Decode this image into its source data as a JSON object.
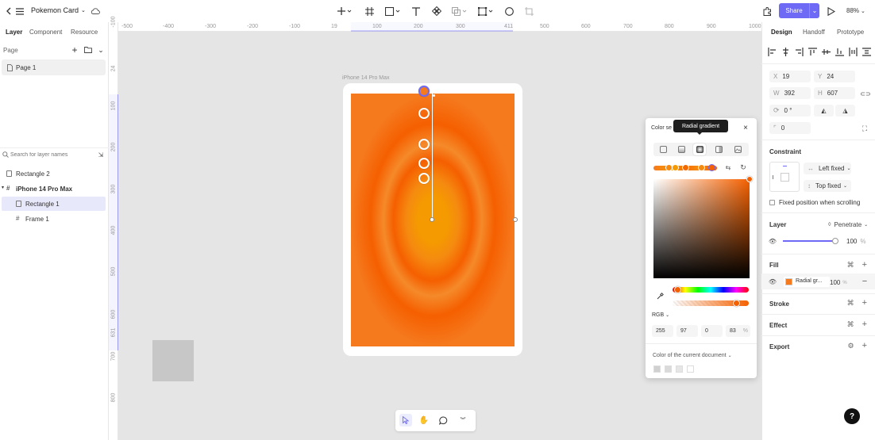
{
  "topbar": {
    "file_name": "Pokemon Card",
    "share_label": "Share",
    "zoom": "88%"
  },
  "left_panel": {
    "tabs": [
      "Layer",
      "Component",
      "Resource"
    ],
    "page_header": "Page",
    "pages": [
      "Page 1"
    ],
    "search_placeholder": "Search for layer names",
    "layers": [
      {
        "name": "Rectangle 2",
        "indent": 0,
        "bold": false,
        "selected": false
      },
      {
        "name": "iPhone 14 Pro Max",
        "indent": 0,
        "bold": true,
        "selected": false
      },
      {
        "name": "Rectangle 1",
        "indent": 1,
        "bold": false,
        "selected": true
      },
      {
        "name": "Frame 1",
        "indent": 1,
        "bold": false,
        "selected": false
      }
    ]
  },
  "ruler_h": [
    "-500",
    "-400",
    "-300",
    "-200",
    "-100",
    "19",
    "100",
    "200",
    "300",
    "411",
    "500",
    "600",
    "700",
    "800",
    "900",
    "1000"
  ],
  "ruler_v": [
    "-100",
    "24",
    "100",
    "200",
    "300",
    "400",
    "500",
    "600",
    "631",
    "700",
    "800"
  ],
  "canvas": {
    "frame_label": "iPhone 14 Pro Max"
  },
  "color_popup": {
    "title": "Color se",
    "tooltip": "Radial gradient",
    "mode": "RGB",
    "r": "255",
    "g": "97",
    "b": "0",
    "alpha": "83",
    "alpha_unit": "%",
    "doc_colors_label": "Color of the current document",
    "doc_swatches": [
      "#d0d0d0",
      "#dadada",
      "#e6e6e6",
      "#ffffff"
    ],
    "hue_fraction": 0.06,
    "opacity_fraction": 0.83
  },
  "right_panel": {
    "tabs": [
      "Design",
      "Handoff",
      "Prototype"
    ],
    "x_label": "X",
    "x": "19",
    "y_label": "Y",
    "y": "24",
    "w_label": "W",
    "w": "392",
    "h_label": "H",
    "h": "607",
    "rotation": "0 °",
    "radius": "0",
    "constraint_title": "Constraint",
    "constraint_h": "Left fixed",
    "constraint_v": "Top fixed",
    "fixed_scroll": "Fixed position when scrolling",
    "layer_title": "Layer",
    "blend": "Penetrate",
    "layer_opacity": "100",
    "layer_opacity_unit": "%",
    "layer_opacity_fraction": 1.0,
    "fill_title": "Fill",
    "fill_name": "Radial gr...",
    "fill_opacity": "100",
    "fill_opacity_unit": "%",
    "stroke_title": "Stroke",
    "effect_title": "Effect",
    "export_title": "Export"
  },
  "bottom_toolbar": {
    "help": "?"
  },
  "colors": {
    "accent": "#6e6af5",
    "orange": "#f57a1e",
    "gradient_center": "#f59a00",
    "gradient_ring": "#f55f00"
  }
}
